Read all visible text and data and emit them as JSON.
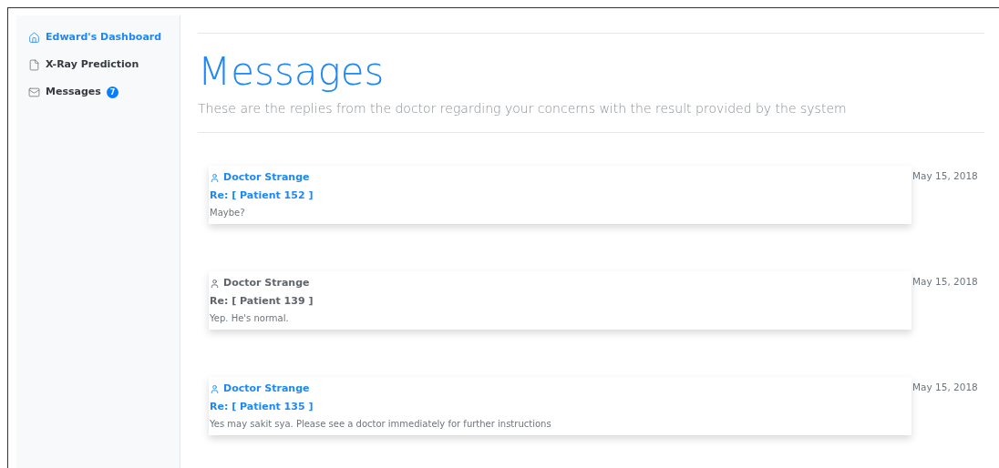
{
  "sidebar": {
    "items": [
      {
        "label": "Edward's Dashboard",
        "kind": "home",
        "selected": true
      },
      {
        "label": "X-Ray Prediction",
        "kind": "file",
        "selected": false
      },
      {
        "label": "Messages",
        "kind": "mail",
        "selected": false,
        "badge": "7"
      }
    ]
  },
  "header": {
    "title": "Messages",
    "subtitle": "These are the replies from the doctor regarding your concerns with the result provided by the system"
  },
  "messages": [
    {
      "sender": "Doctor Strange",
      "subject": "Re: [ Patient 152 ]",
      "body": "Maybe?",
      "date": "May 15, 2018",
      "unread": true
    },
    {
      "sender": "Doctor Strange",
      "subject": "Re: [ Patient 139 ]",
      "body": "Yep. He's normal.",
      "date": "May 15, 2018",
      "unread": false
    },
    {
      "sender": "Doctor Strange",
      "subject": "Re: [ Patient 135 ]",
      "body": "Yes may sakit sya. Please see a doctor immediately for further instructions",
      "date": "May 15, 2018",
      "unread": true
    }
  ]
}
